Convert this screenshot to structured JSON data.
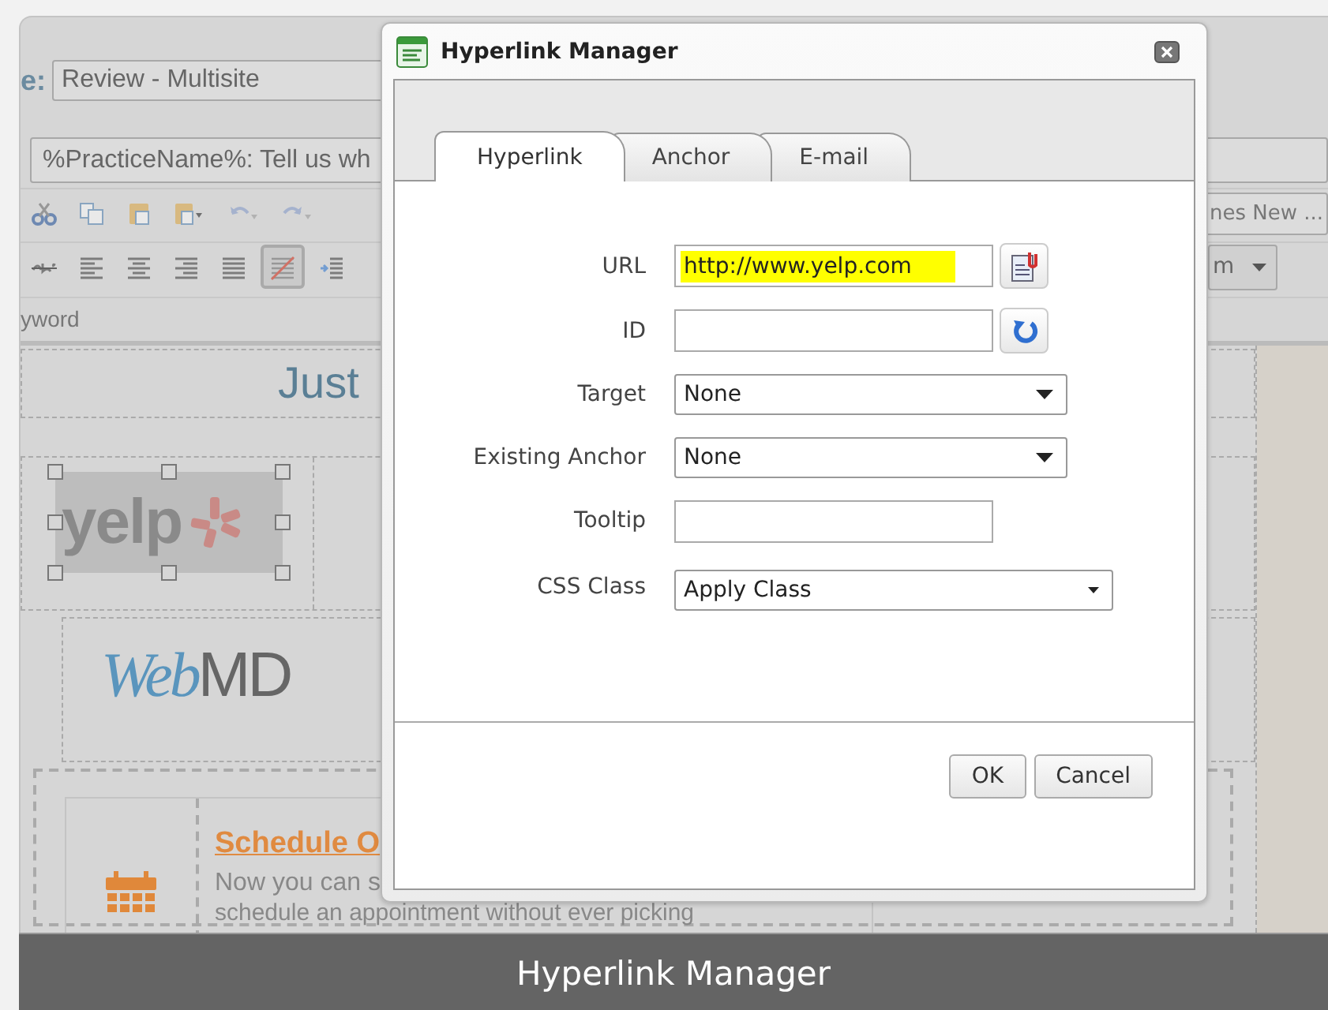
{
  "editor": {
    "name_label": "e:",
    "name_field": "Review - Multisite",
    "subject_field": "%PracticeName%: Tell us wh",
    "toolbar_rows": [
      [
        {
          "kind": "cut",
          "selected": false
        },
        {
          "kind": "copy",
          "selected": false
        },
        {
          "kind": "paste",
          "selected": false
        },
        {
          "kind": "paste-menu",
          "selected": false
        },
        {
          "kind": "undo",
          "selected": false
        },
        {
          "kind": "redo",
          "selected": false
        }
      ],
      [
        {
          "kind": "strike",
          "selected": false
        },
        {
          "kind": "align-left",
          "selected": false
        },
        {
          "kind": "align-center",
          "selected": false
        },
        {
          "kind": "align-right",
          "selected": false
        },
        {
          "kind": "justify",
          "selected": false
        },
        {
          "kind": "slash",
          "selected": true
        },
        {
          "kind": "indent",
          "selected": false
        }
      ]
    ],
    "font_field": "nes New ...",
    "size_field": "m",
    "keyword_text": "yword",
    "heading": "Just",
    "logos": [
      {
        "kind": "burst",
        "text": "yelp",
        "selected": true
      },
      {
        "kind": "split",
        "prefix": "Web",
        "suffix": "MD",
        "selected": false
      }
    ],
    "card": {
      "title": "Schedule O",
      "lines": [
        "Now you can s",
        "schedule an appointment without ever picking"
      ]
    }
  },
  "dialog": {
    "title": "Hyperlink Manager",
    "tabs": [
      {
        "label": "Hyperlink",
        "selected": true
      },
      {
        "label": "Anchor",
        "selected": false
      },
      {
        "label": "E-mail",
        "selected": false
      }
    ],
    "fields": [
      {
        "label": "URL",
        "kind": "text",
        "value": "http://www.yelp.com",
        "highlighted": true,
        "button": {
          "kind": "document"
        }
      },
      {
        "label": "ID",
        "kind": "text",
        "highlighted": false,
        "button": {
          "kind": "refresh"
        }
      },
      {
        "label": "Target",
        "kind": "select",
        "value": "None",
        "highlighted": false
      },
      {
        "label": "Existing Anchor",
        "kind": "select",
        "value": "None",
        "highlighted": false
      },
      {
        "label": "Tooltip",
        "kind": "text",
        "highlighted": false
      },
      {
        "label": "CSS Class",
        "kind": "class-select",
        "value": "Apply Class",
        "highlighted": false
      }
    ],
    "buttons": [
      "OK",
      "Cancel"
    ]
  },
  "caption": "Hyperlink Manager"
}
